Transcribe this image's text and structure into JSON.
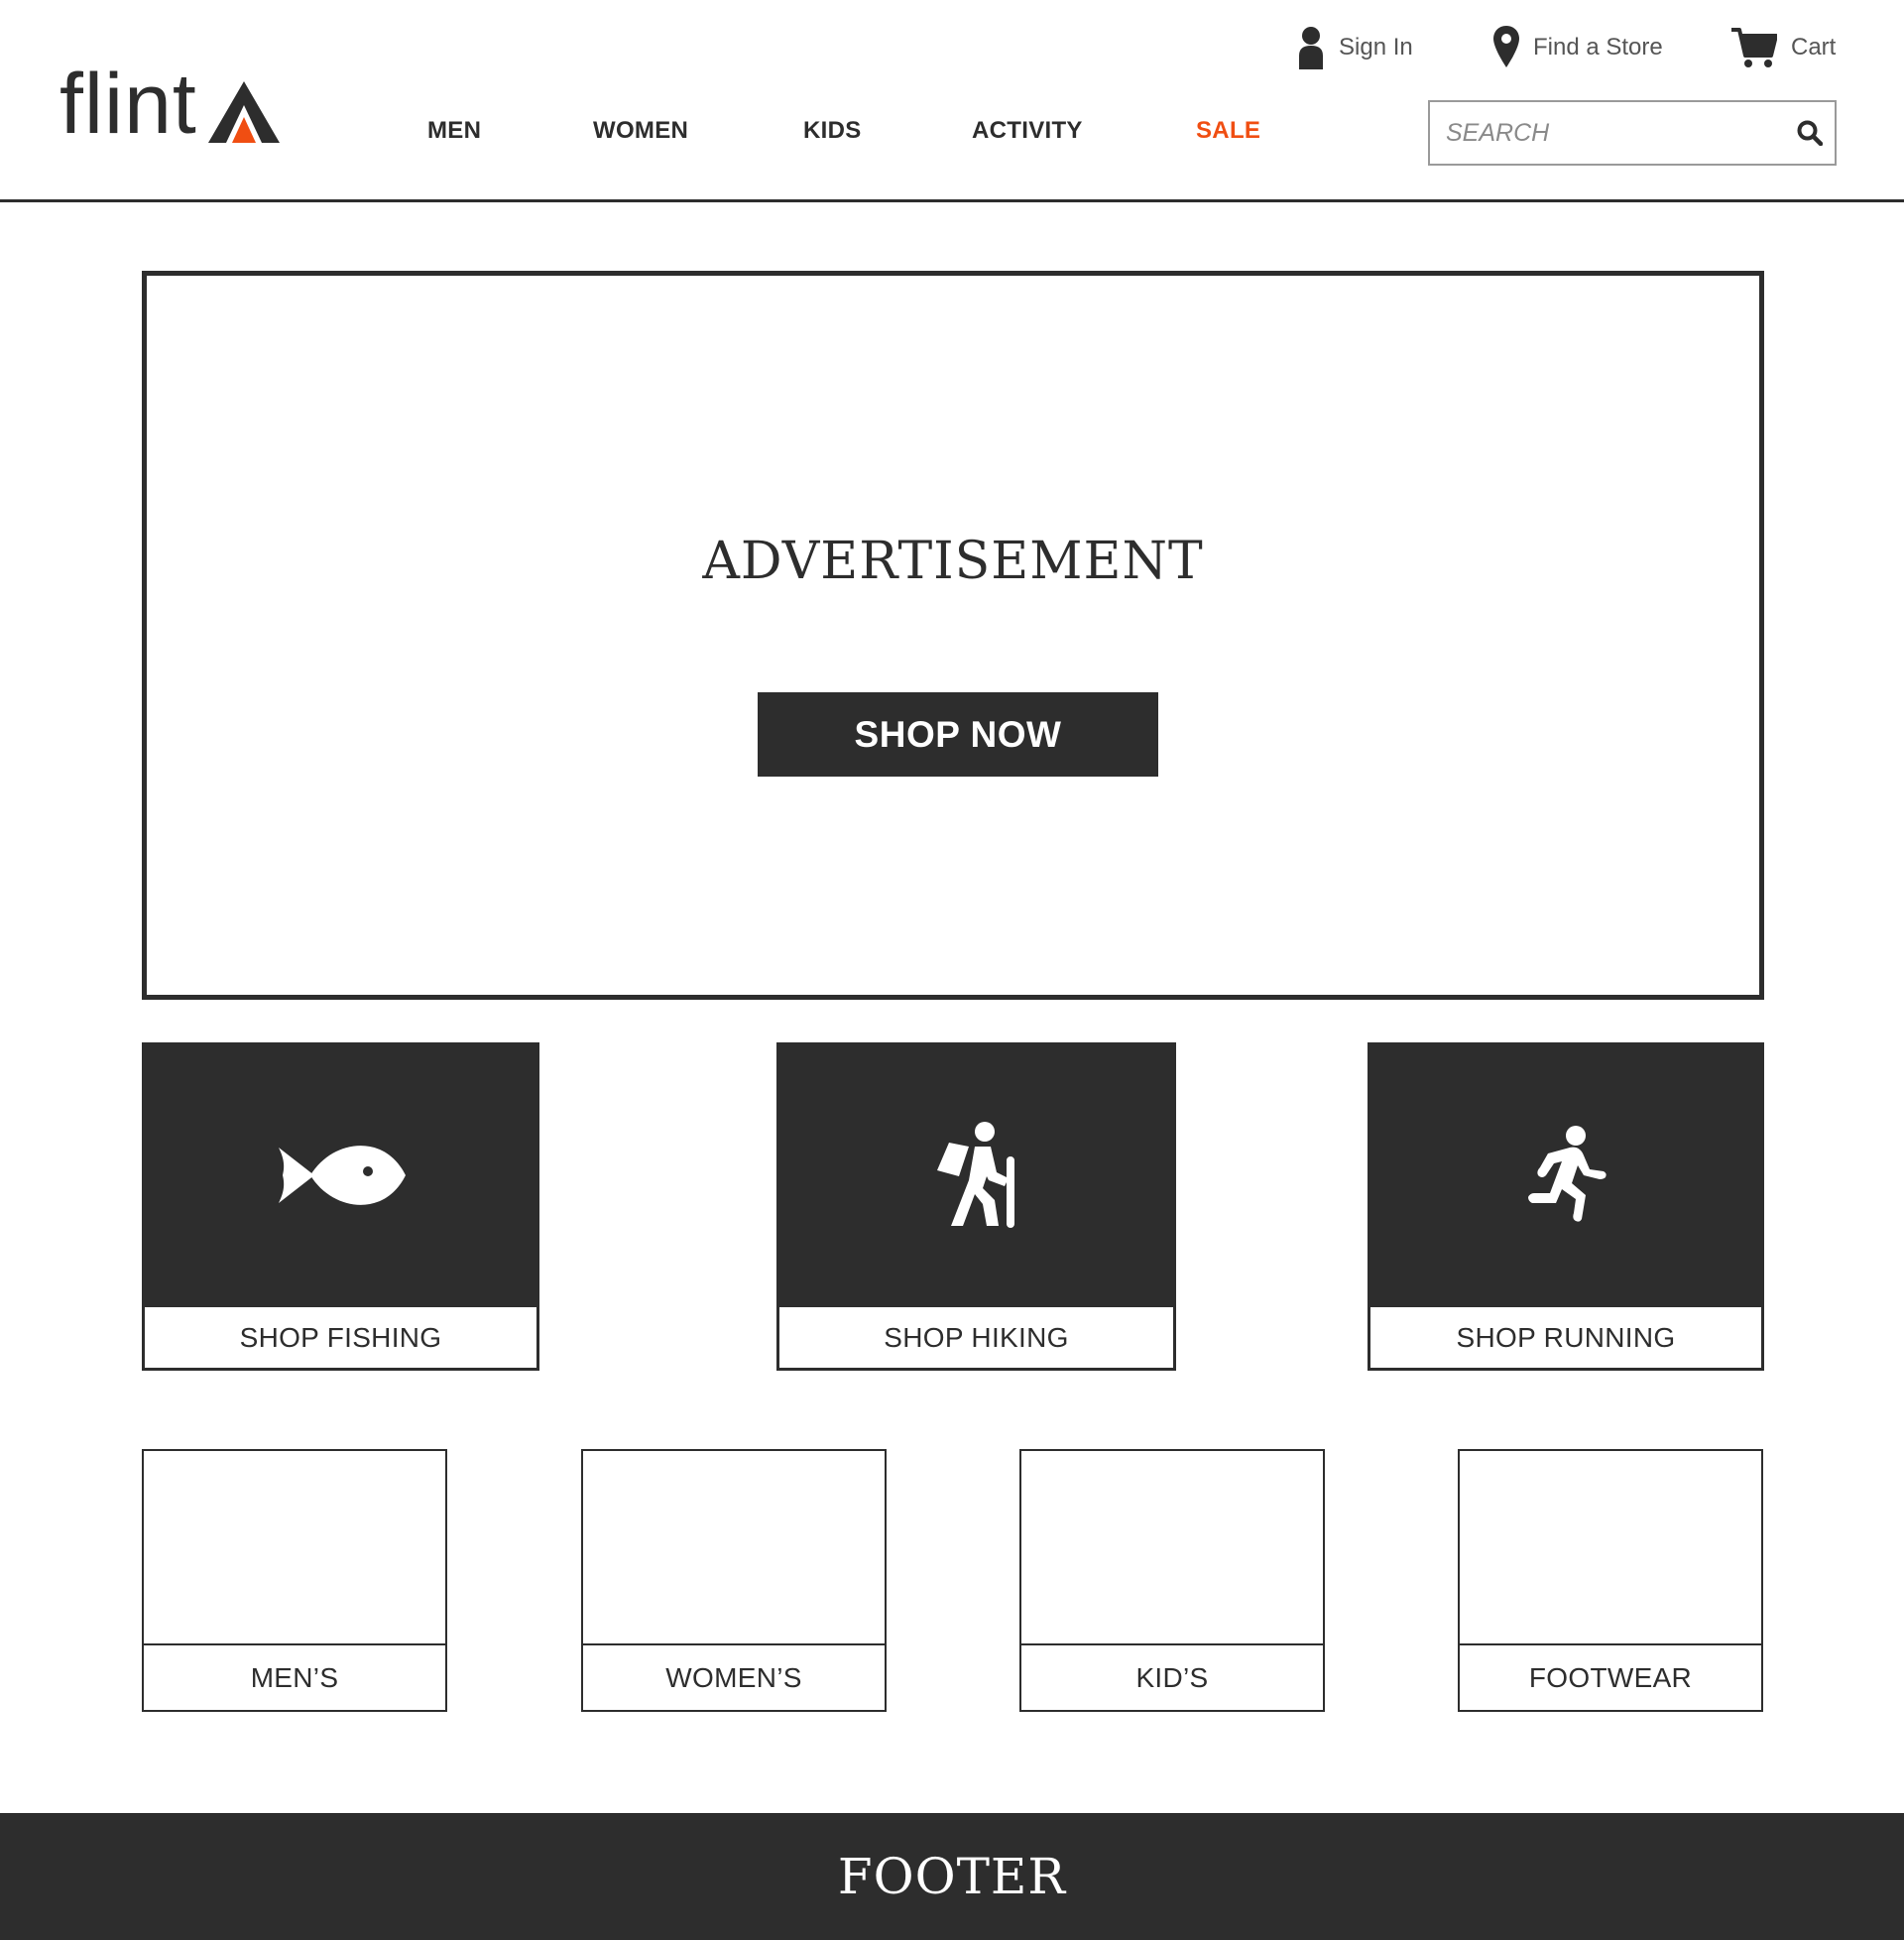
{
  "brand": {
    "name": "flint",
    "accent_color": "#f04e12",
    "dark_color": "#2d2d2d"
  },
  "utility_nav": {
    "sign_in": "Sign In",
    "find_store": "Find a Store",
    "cart": "Cart"
  },
  "nav": {
    "items": [
      {
        "label": "MEN"
      },
      {
        "label": "WOMEN"
      },
      {
        "label": "KIDS"
      },
      {
        "label": "ACTIVITY"
      },
      {
        "label": "SALE"
      }
    ]
  },
  "search": {
    "placeholder": "SEARCH",
    "value": ""
  },
  "hero": {
    "title": "ADVERTISEMENT",
    "cta": "SHOP NOW"
  },
  "activities": [
    {
      "label": "SHOP FISHING",
      "icon": "fish-icon"
    },
    {
      "label": "SHOP HIKING",
      "icon": "hiker-icon"
    },
    {
      "label": "SHOP RUNNING",
      "icon": "runner-icon"
    }
  ],
  "categories": [
    {
      "label": "MEN’S"
    },
    {
      "label": "WOMEN’S"
    },
    {
      "label": "KID’S"
    },
    {
      "label": "FOOTWEAR"
    }
  ],
  "footer": {
    "title": "FOOTER"
  }
}
